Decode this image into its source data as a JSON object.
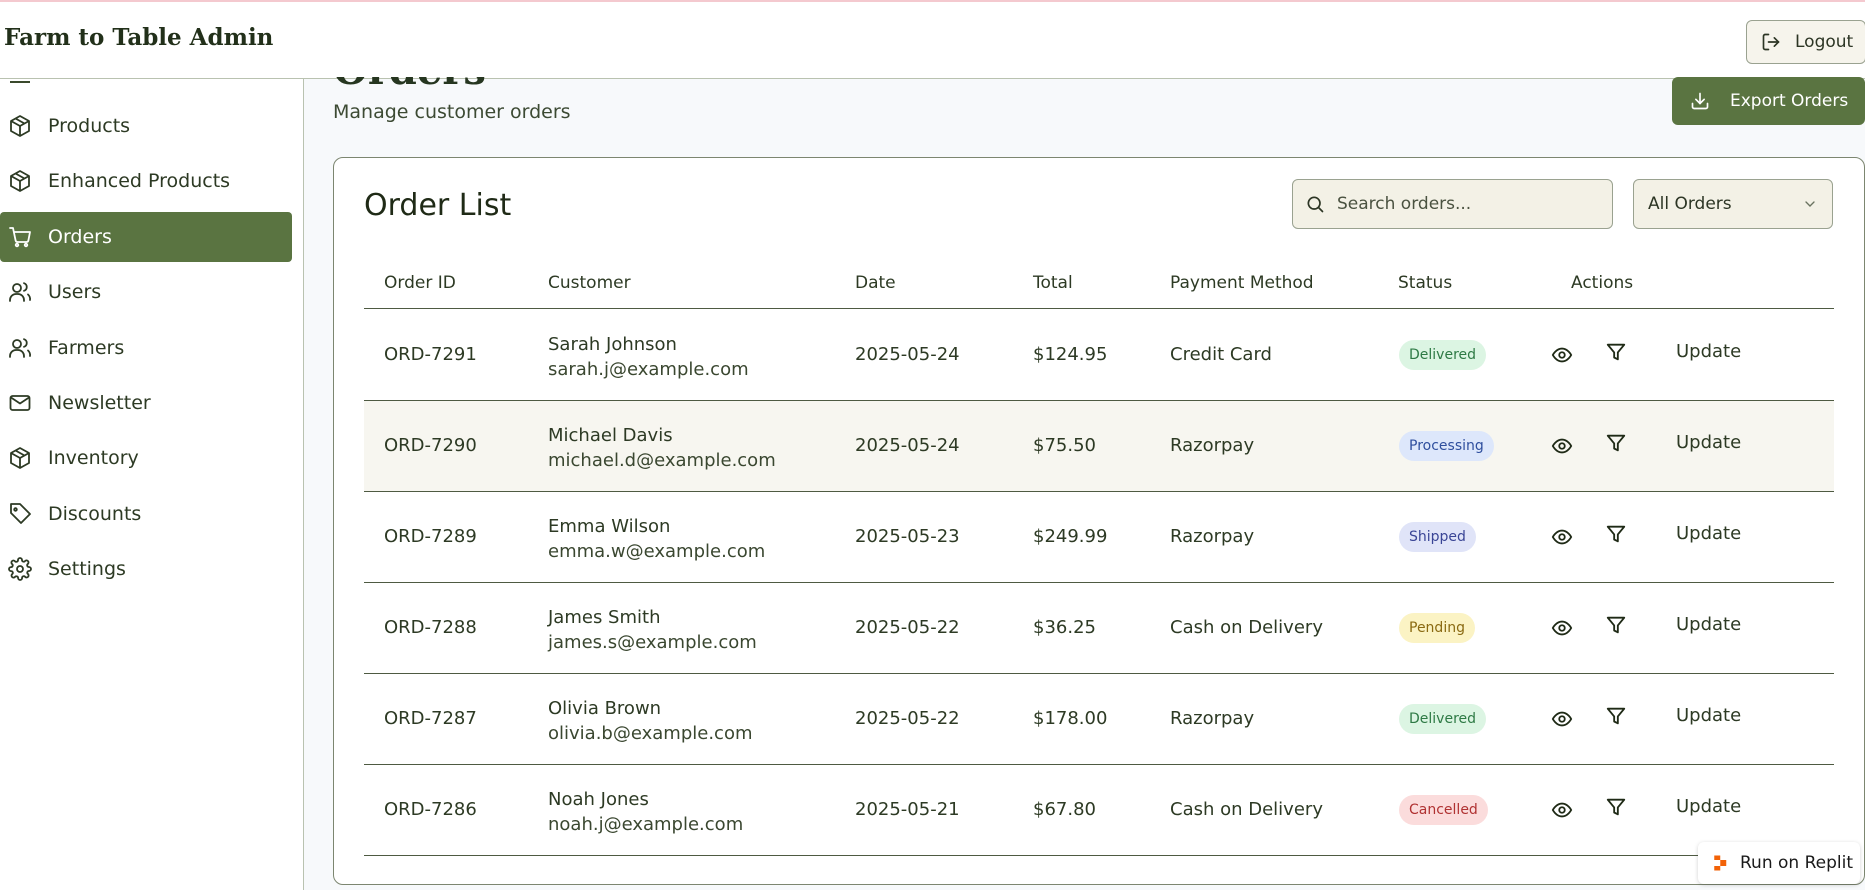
{
  "app": {
    "title": "Farm to Table Admin",
    "logout_label": "Logout"
  },
  "sidebar": {
    "items": [
      {
        "label": "Products",
        "icon": "package-icon"
      },
      {
        "label": "Enhanced Products",
        "icon": "package-icon"
      },
      {
        "label": "Orders",
        "icon": "cart-icon",
        "active": true
      },
      {
        "label": "Users",
        "icon": "users-icon"
      },
      {
        "label": "Farmers",
        "icon": "users-icon"
      },
      {
        "label": "Newsletter",
        "icon": "mail-icon"
      },
      {
        "label": "Inventory",
        "icon": "package-icon"
      },
      {
        "label": "Discounts",
        "icon": "tag-icon"
      },
      {
        "label": "Settings",
        "icon": "gear-icon"
      }
    ]
  },
  "page": {
    "title": "Orders",
    "subtitle": "Manage customer orders",
    "export_label": "Export Orders"
  },
  "order_list": {
    "title": "Order List",
    "search_placeholder": "Search orders...",
    "filter_value": "All Orders",
    "columns": [
      "Order ID",
      "Customer",
      "Date",
      "Total",
      "Payment Method",
      "Status",
      "Actions"
    ],
    "rows": [
      {
        "id": "ORD-7291",
        "name": "Sarah Johnson",
        "email": "sarah.j@example.com",
        "date": "2025-05-24",
        "total": "$124.95",
        "payment": "Credit Card",
        "status": "Delivered",
        "update_label": "Update"
      },
      {
        "id": "ORD-7290",
        "name": "Michael Davis",
        "email": "michael.d@example.com",
        "date": "2025-05-24",
        "total": "$75.50",
        "payment": "Razorpay",
        "status": "Processing",
        "update_label": "Update"
      },
      {
        "id": "ORD-7289",
        "name": "Emma Wilson",
        "email": "emma.w@example.com",
        "date": "2025-05-23",
        "total": "$249.99",
        "payment": "Razorpay",
        "status": "Shipped",
        "update_label": "Update"
      },
      {
        "id": "ORD-7288",
        "name": "James Smith",
        "email": "james.s@example.com",
        "date": "2025-05-22",
        "total": "$36.25",
        "payment": "Cash on Delivery",
        "status": "Pending",
        "update_label": "Update"
      },
      {
        "id": "ORD-7287",
        "name": "Olivia Brown",
        "email": "olivia.b@example.com",
        "date": "2025-05-22",
        "total": "$178.00",
        "payment": "Razorpay",
        "status": "Delivered",
        "update_label": "Update"
      },
      {
        "id": "ORD-7286",
        "name": "Noah Jones",
        "email": "noah.j@example.com",
        "date": "2025-05-21",
        "total": "$67.80",
        "payment": "Cash on Delivery",
        "status": "Cancelled",
        "update_label": "Update"
      }
    ]
  },
  "status_colors": {
    "Delivered": {
      "bg": "#dcf5e3",
      "fg": "#2e7a45"
    },
    "Processing": {
      "bg": "#dde7fb",
      "fg": "#2f4f9e"
    },
    "Shipped": {
      "bg": "#e0e4f8",
      "fg": "#3a4596"
    },
    "Pending": {
      "bg": "#fbf3c4",
      "fg": "#8a6a12"
    },
    "Cancelled": {
      "bg": "#fbdcdc",
      "fg": "#b03232"
    }
  },
  "colors": {
    "accent": "#5a7441"
  },
  "replit_badge": {
    "label": "Run on Replit"
  }
}
